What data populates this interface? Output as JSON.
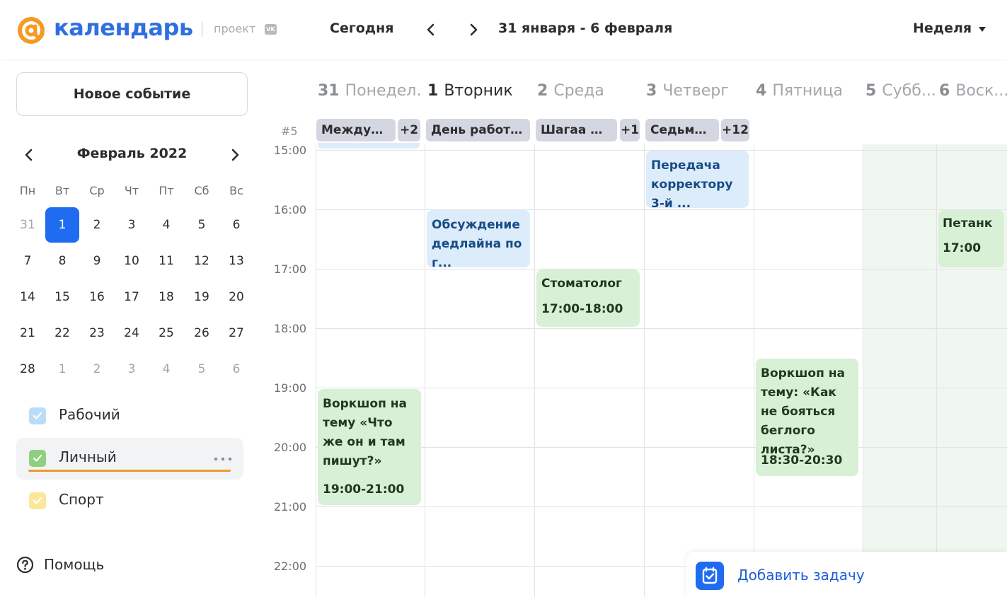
{
  "header": {
    "logo_word": "календарь",
    "project_label": "проект",
    "vk_badge": "VK",
    "today_label": "Сегодня",
    "date_range": "31 января - 6 февраля",
    "view_label": "Неделя"
  },
  "sidebar": {
    "new_event_label": "Новое событие",
    "mini_calendar": {
      "title": "Февраль 2022",
      "weekdays": [
        "Пн",
        "Вт",
        "Ср",
        "Чт",
        "Пт",
        "Сб",
        "Вс"
      ],
      "weeks": [
        [
          "31",
          "1",
          "2",
          "3",
          "4",
          "5",
          "6"
        ],
        [
          "7",
          "8",
          "9",
          "10",
          "11",
          "12",
          "13"
        ],
        [
          "14",
          "15",
          "16",
          "17",
          "18",
          "19",
          "20"
        ],
        [
          "21",
          "22",
          "23",
          "24",
          "25",
          "26",
          "27"
        ],
        [
          "28",
          "1",
          "2",
          "3",
          "4",
          "5",
          "6"
        ]
      ]
    },
    "calendars": [
      {
        "label": "Рабочий",
        "color": "#b9dcf8"
      },
      {
        "label": "Личный",
        "color": "#8ed07f"
      },
      {
        "label": "Спорт",
        "color": "#fbe79a"
      }
    ],
    "help_label": "Помощь"
  },
  "week": {
    "week_number": "#5",
    "days": [
      {
        "num": "31",
        "name": "Понедел..."
      },
      {
        "num": "1",
        "name": "Вторник"
      },
      {
        "num": "2",
        "name": "Среда"
      },
      {
        "num": "3",
        "name": "Четверг"
      },
      {
        "num": "4",
        "name": "Пятница"
      },
      {
        "num": "5",
        "name": "Субб..."
      },
      {
        "num": "6",
        "name": "Воск..."
      }
    ],
    "allday": [
      {
        "label": "Междуна...",
        "more": "+2"
      },
      {
        "label": "День работн..."
      },
      {
        "label": "Шагаа — ...",
        "more": "+1"
      },
      {
        "label": "Седьма...",
        "more": "+12"
      }
    ],
    "times": [
      "15:00",
      "16:00",
      "17:00",
      "18:00",
      "19:00",
      "20:00",
      "21:00",
      "22:00"
    ]
  },
  "events": {
    "transfer": {
      "title": "Передача корректору 3-й ..."
    },
    "discussion": {
      "title": "Обсуждение дедлайна по г..."
    },
    "petanque": {
      "title": "Петанк",
      "time": "17:00"
    },
    "dentist": {
      "title": "Стоматолог",
      "time": "17:00-18:00"
    },
    "workshop_fri": {
      "title": "Воркшоп на тему: «Как не бояться беглого листа?»",
      "time": "18:30-20:30"
    },
    "workshop_mon": {
      "title": "Воркшоп на тему «Что же он и там пишут?»",
      "time": "19:00-21:00"
    }
  },
  "add_task_label": "Добавить задачу",
  "colors": {
    "accent": "#1f6cf0",
    "brand_orange": "#f59b22",
    "event_blue_bg": "#dcecfb",
    "event_green_bg": "#d8f0d6",
    "allday_chip_bg": "#d4d6e2",
    "weekend_bg": "#f0f7f0"
  }
}
